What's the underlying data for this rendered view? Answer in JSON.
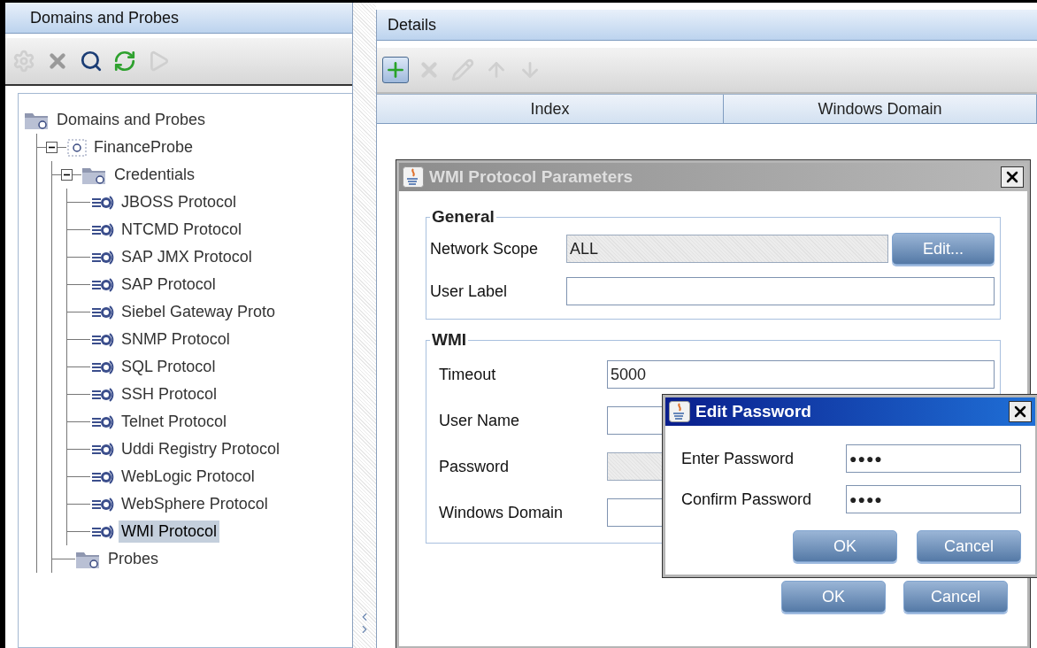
{
  "left_panel": {
    "title": "Domains and Probes",
    "toolbar": [
      {
        "kind": "gear",
        "disabled": true
      },
      {
        "kind": "delete",
        "disabled": false
      },
      {
        "kind": "search",
        "disabled": false
      },
      {
        "kind": "refresh",
        "disabled": false
      },
      {
        "kind": "run",
        "disabled": true
      }
    ],
    "tree": [
      {
        "label": "Domains and Probes",
        "kind": "domains",
        "selected": false,
        "children": [
          {
            "label": "FinanceProbe",
            "kind": "probe",
            "expanded": true,
            "selected": false,
            "children": [
              {
                "label": "Credentials",
                "kind": "folder",
                "expanded": true,
                "selected": false,
                "children": [
                  {
                    "label": "JBOSS Protocol",
                    "kind": "protocol",
                    "selected": false
                  },
                  {
                    "label": "NTCMD Protocol",
                    "kind": "protocol",
                    "selected": false
                  },
                  {
                    "label": "SAP JMX Protocol",
                    "kind": "protocol",
                    "selected": false
                  },
                  {
                    "label": "SAP Protocol",
                    "kind": "protocol",
                    "selected": false
                  },
                  {
                    "label": "Siebel Gateway Proto",
                    "kind": "protocol",
                    "selected": false
                  },
                  {
                    "label": "SNMP Protocol",
                    "kind": "protocol",
                    "selected": false
                  },
                  {
                    "label": "SQL Protocol",
                    "kind": "protocol",
                    "selected": false
                  },
                  {
                    "label": "SSH Protocol",
                    "kind": "protocol",
                    "selected": false
                  },
                  {
                    "label": "Telnet Protocol",
                    "kind": "protocol",
                    "selected": false
                  },
                  {
                    "label": "Uddi Registry Protocol",
                    "kind": "protocol",
                    "selected": false
                  },
                  {
                    "label": "WebLogic Protocol",
                    "kind": "protocol",
                    "selected": false
                  },
                  {
                    "label": "WebSphere Protocol",
                    "kind": "protocol",
                    "selected": false
                  },
                  {
                    "label": "WMI Protocol",
                    "kind": "protocol",
                    "selected": true
                  }
                ]
              },
              {
                "label": "Probes",
                "kind": "folder",
                "selected": false
              }
            ]
          }
        ]
      }
    ]
  },
  "details_panel": {
    "title": "Details",
    "toolbar": [
      {
        "kind": "add",
        "disabled": false,
        "active": true
      },
      {
        "kind": "delete",
        "disabled": true,
        "active": false
      },
      {
        "kind": "edit",
        "disabled": true,
        "active": false
      },
      {
        "kind": "up",
        "disabled": true,
        "active": false
      },
      {
        "kind": "down",
        "disabled": true,
        "active": false
      }
    ],
    "table": {
      "columns": [
        "Index",
        "Windows Domain"
      ]
    }
  },
  "wmi_dialog": {
    "title": "WMI Protocol Parameters",
    "active": false,
    "general": {
      "legend": "General",
      "fields": [
        {
          "label": "Network Scope",
          "value": "ALL",
          "disabled": true,
          "button": "Edit..."
        },
        {
          "label": "User Label",
          "disabled": false
        }
      ]
    },
    "wmi": {
      "legend": "WMI",
      "fields": [
        {
          "label": "Timeout",
          "value": "5000",
          "disabled": false
        },
        {
          "label": "User Name",
          "disabled": false
        },
        {
          "label": "Password",
          "disabled": true
        },
        {
          "label": "Windows Domain",
          "disabled": false
        }
      ]
    },
    "buttons": [
      "OK",
      "Cancel"
    ]
  },
  "password_dialog": {
    "title": "Edit Password",
    "active": true,
    "fields": [
      {
        "label": "Enter Password",
        "value": "●●●●"
      },
      {
        "label": "Confirm Password",
        "value": "●●●●"
      }
    ],
    "buttons": [
      "OK",
      "Cancel"
    ]
  }
}
